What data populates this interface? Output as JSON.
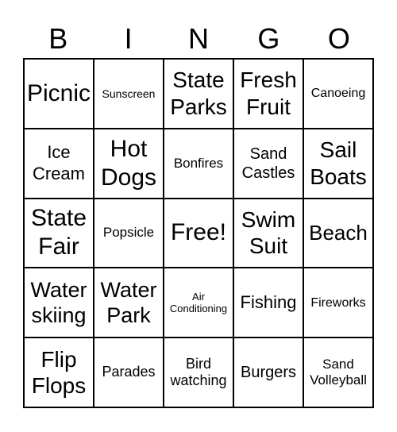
{
  "header": [
    "B",
    "I",
    "N",
    "G",
    "O"
  ],
  "cells": [
    "Picnic",
    "Sunscreen",
    "State Parks",
    "Fresh Fruit",
    "Canoeing",
    "Ice Cream",
    "Hot Dogs",
    "Bonfires",
    "Sand Castles",
    "Sail Boats",
    "State Fair",
    "Popsicle",
    "Free!",
    "Swim Suit",
    "Beach",
    "Water skiing",
    "Water Park",
    "Air Conditioning",
    "Fishing",
    "Fireworks",
    "Flip Flops",
    "Parades",
    "Bird watching",
    "Burgers",
    "Sand Volleyball"
  ]
}
